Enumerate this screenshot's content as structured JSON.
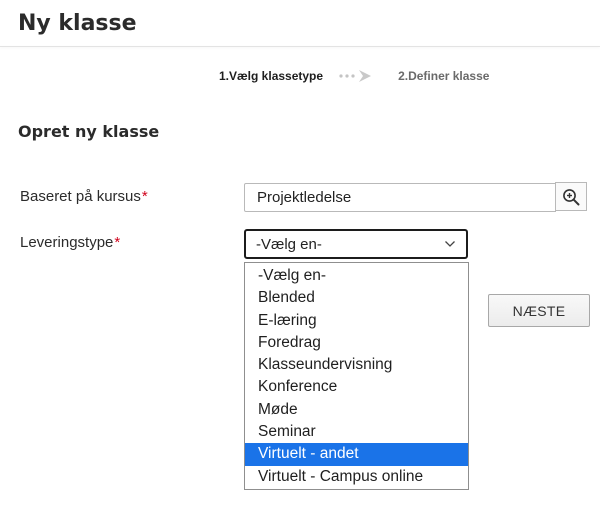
{
  "page": {
    "title": "Ny klasse"
  },
  "wizard": {
    "step1": "1.Vælg klassetype",
    "step2": "2.Definer klasse"
  },
  "section": {
    "title": "Opret ny klasse"
  },
  "form": {
    "course": {
      "label": "Baseret på kursus",
      "required_mark": "*",
      "value": "Projektledelse",
      "search_icon": "search-plus-icon"
    },
    "delivery": {
      "label": "Leveringstype",
      "required_mark": "*",
      "selected": "-Vælg en-",
      "options": [
        "-Vælg en-",
        "Blended",
        "E-læring",
        "Foredrag",
        "Klasseundervisning",
        "Konference",
        "Møde",
        "Seminar",
        "Virtuelt - andet",
        "Virtuelt - Campus online"
      ],
      "highlighted_option": "Virtuelt - andet"
    }
  },
  "buttons": {
    "next": "NÆSTE"
  },
  "colors": {
    "required": "#d0021b",
    "highlight": "#1a73e8"
  }
}
